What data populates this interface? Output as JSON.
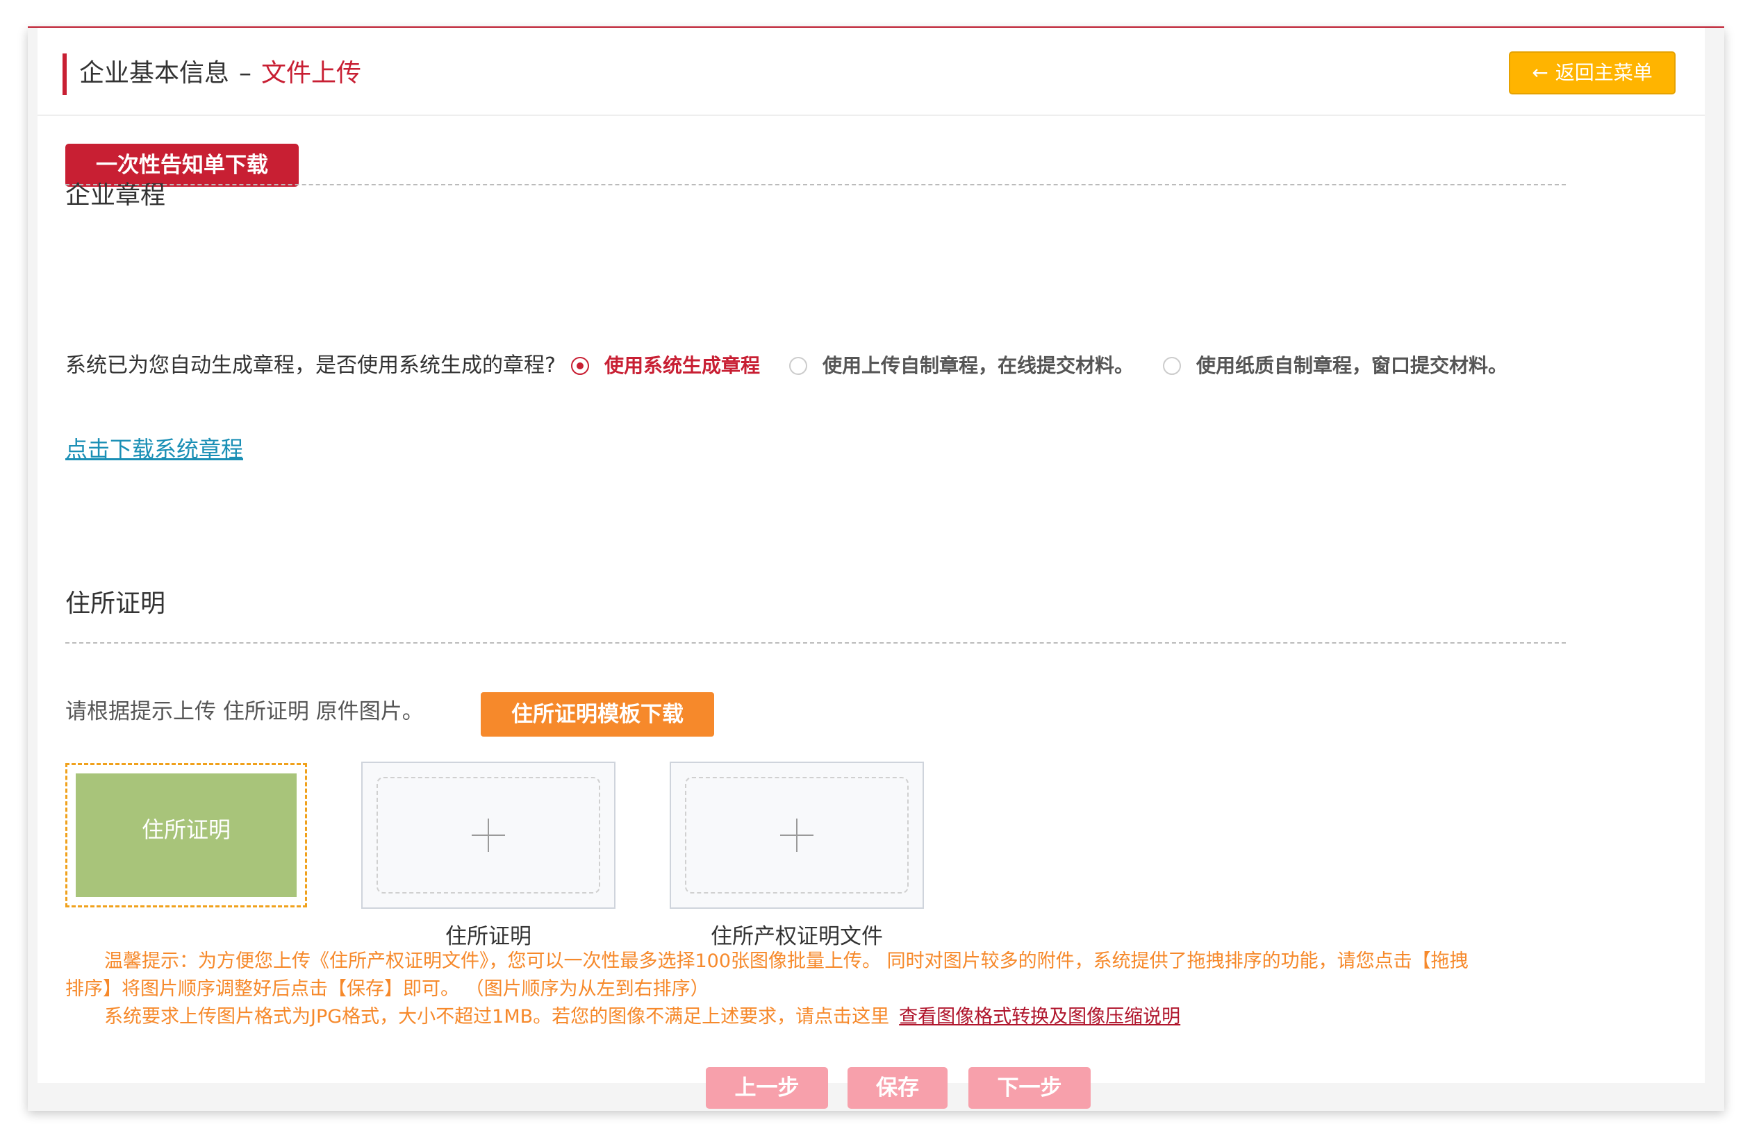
{
  "header": {
    "title_main": "企业基本信息",
    "title_sep": "–",
    "title_sub": "文件上传",
    "back_label": "返回主菜单",
    "back_arrow": "←"
  },
  "notice": {
    "label": "一次性告知单下载"
  },
  "charter": {
    "section_title": "企业章程",
    "question": "系统已为您自动生成章程，是否使用系统生成的章程?",
    "options": [
      {
        "label": "使用系统生成章程",
        "checked": true
      },
      {
        "label": "使用上传自制章程，在线提交材料。",
        "checked": false
      },
      {
        "label": "使用纸质自制章程，窗口提交材料。",
        "checked": false
      }
    ],
    "download_link": "点击下载系统章程"
  },
  "residence": {
    "section_title": "住所证明",
    "upload_tip": "请根据提示上传 住所证明 原件图片。",
    "template_button": "住所证明模板下载",
    "sample_label": "住所证明",
    "slots": [
      {
        "label": "住所证明"
      },
      {
        "label": "住所产权证明文件"
      }
    ],
    "hint_line1": "温馨提示：为方便您上传《住所产权证明文件》，您可以一次性最多选择100张图像批量上传。 同时对图片较多的附件，系统提供了拖拽排序的功能，请您点击【拖拽",
    "hint_line2": "排序】将图片顺序调整好后点击【保存】即可。 （图片顺序为从左到右排序）",
    "hint_line3": "系统要求上传图片格式为JPG格式，大小不超过1MB。若您的图像不满足上述要求，请点击这里",
    "hint_link": "查看图像格式转换及图像压缩说明"
  },
  "footer": {
    "prev_label": "上一步",
    "save_label": "保存",
    "next_label": "下一步"
  },
  "colors": {
    "brand_red": "#c81f33",
    "warning_yellow": "#ffb400",
    "orange": "#f6892b",
    "link_blue": "#1a8fb5",
    "sample_green": "#a8c47a",
    "disabled_pink": "#f7a0ab"
  }
}
